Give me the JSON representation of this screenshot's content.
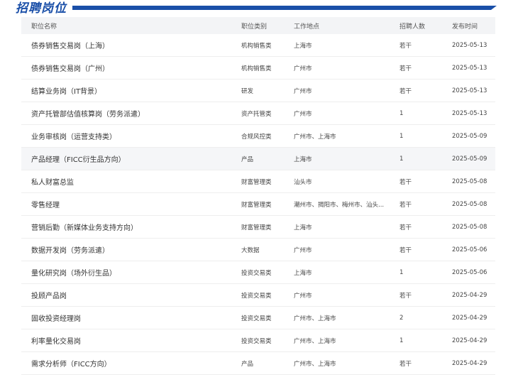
{
  "header": {
    "title": "招聘岗位"
  },
  "columns": {
    "name": "职位名称",
    "category": "职位类别",
    "location": "工作地点",
    "count": "招聘人数",
    "date": "发布时间"
  },
  "jobs": [
    {
      "name": "债券销售交易岗（上海）",
      "category": "机构销售类",
      "location": "上海市",
      "count": "若干",
      "date": "2025-05-13"
    },
    {
      "name": "债券销售交易岗（广州）",
      "category": "机构销售类",
      "location": "广州市",
      "count": "若干",
      "date": "2025-05-13"
    },
    {
      "name": "结算业务岗（IT背景）",
      "category": "研发",
      "location": "广州市",
      "count": "若干",
      "date": "2025-05-13"
    },
    {
      "name": "资产托管部估值核算岗（劳务派遣）",
      "category": "资产托管类",
      "location": "广州市",
      "count": "1",
      "date": "2025-05-13"
    },
    {
      "name": "业务审核岗（运营支持类）",
      "category": "合规风控类",
      "location": "广州市、上海市",
      "count": "1",
      "date": "2025-05-09"
    },
    {
      "name": "产品经理（FICC衍生品方向）",
      "category": "产品",
      "location": "上海市",
      "count": "1",
      "date": "2025-05-09"
    },
    {
      "name": "私人财富总监",
      "category": "财富管理类",
      "location": "汕头市",
      "count": "若干",
      "date": "2025-05-08"
    },
    {
      "name": "零售经理",
      "category": "财富管理类",
      "location": "潮州市、揭阳市、梅州市、汕头...",
      "count": "若干",
      "date": "2025-05-08"
    },
    {
      "name": "营销后勤（新媒体业务支持方向）",
      "category": "财富管理类",
      "location": "上海市",
      "count": "若干",
      "date": "2025-05-08"
    },
    {
      "name": "数据开发岗（劳务派遣）",
      "category": "大数据",
      "location": "广州市",
      "count": "若干",
      "date": "2025-05-06"
    },
    {
      "name": "量化研究岗（场外衍生品）",
      "category": "投资交易类",
      "location": "上海市",
      "count": "1",
      "date": "2025-05-06"
    },
    {
      "name": "投顾产品岗",
      "category": "投资交易类",
      "location": "广州市",
      "count": "若干",
      "date": "2025-04-29"
    },
    {
      "name": "固收投资经理岗",
      "category": "投资交易类",
      "location": "广州市、上海市",
      "count": "2",
      "date": "2025-04-29"
    },
    {
      "name": "利率量化交易岗",
      "category": "投资交易类",
      "location": "广州市、上海市",
      "count": "1",
      "date": "2025-04-29"
    },
    {
      "name": "需求分析师（FICC方向）",
      "category": "产品",
      "location": "广州市、上海市",
      "count": "若干",
      "date": "2025-04-29"
    }
  ]
}
